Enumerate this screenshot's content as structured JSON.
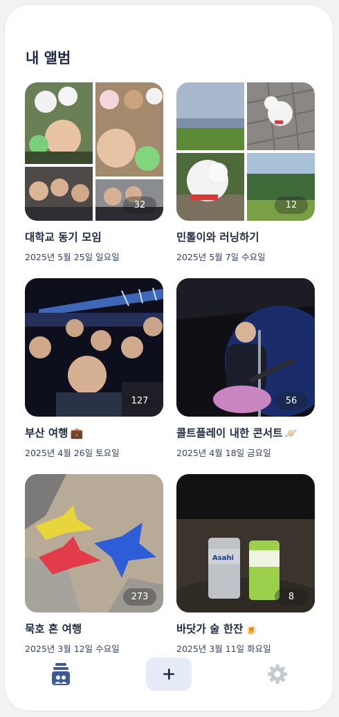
{
  "header": {
    "title": "내 앨범"
  },
  "albums": [
    {
      "title": "대학교 동기 모임",
      "date": "2025년 5월 25일 일요일",
      "count": "32",
      "emoji": ""
    },
    {
      "title": "민톨이와 러닝하기",
      "date": "2025년 5월 7일 수요일",
      "count": "12",
      "emoji": ""
    },
    {
      "title": "부산 여행",
      "date": "2025년 4월 26일 토요일",
      "count": "127",
      "emoji": "💼"
    },
    {
      "title": "콜트플레이 내한 콘서트",
      "date": "2025년 4월 18일 금요일",
      "count": "56",
      "emoji": "🪐"
    },
    {
      "title": "묵호 혼 여행",
      "date": "2025년 3월 12일 수요일",
      "count": "273",
      "emoji": ""
    },
    {
      "title": "바닷가 술 한잔",
      "date": "2025년 3월 11일 화요일",
      "count": "8",
      "emoji": "🍺"
    }
  ],
  "nav": {
    "albums_icon": "album-stack-icon",
    "add_icon": "plus-icon",
    "settings_icon": "gear-icon",
    "active_color": "#3d5a96",
    "inactive_color": "#c4c8cf",
    "add_bg": "#e6ecf7"
  },
  "colors": {
    "text": "#1f2a44",
    "date": "#33416a"
  }
}
